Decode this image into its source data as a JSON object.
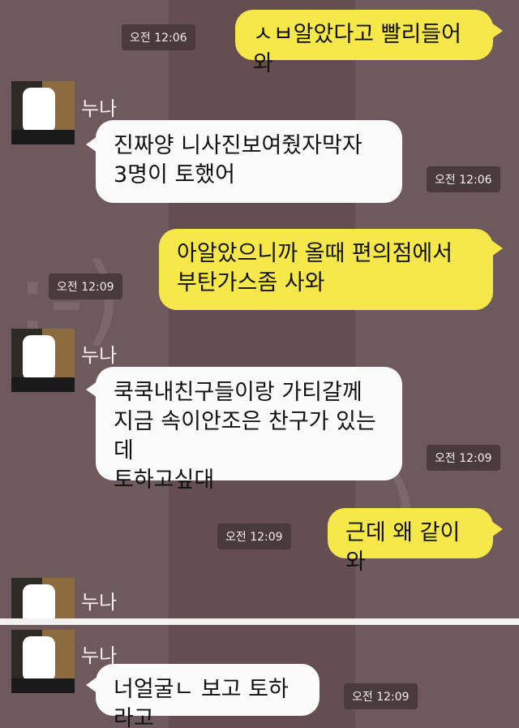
{
  "chat": {
    "sender_name": "누나",
    "messages": [
      {
        "from": "me",
        "lines": [
          "ㅅㅂ알았다고 빨리들어와"
        ],
        "time": "오전 12:06"
      },
      {
        "from": "other",
        "lines": [
          "진짜양 니사진보여줬자막자",
          "3명이 토했어"
        ],
        "time": "오전 12:06"
      },
      {
        "from": "me",
        "lines": [
          "아알았으니까 올때 편의점에서",
          "부탄가스좀 사와"
        ],
        "time": "오전 12:09"
      },
      {
        "from": "other",
        "lines": [
          "쿡쿡내친구들이랑 가티갈께",
          "지금 속이안조은 찬구가 있는데",
          "토하고싶대"
        ],
        "time": "오전 12:09"
      },
      {
        "from": "me",
        "lines": [
          "근데 왜 같이와"
        ],
        "time": "오전 12:09"
      },
      {
        "from": "other",
        "lines": [
          "너얼굴ㄴ 보고 토하라고"
        ],
        "time": "오전 12:09"
      }
    ]
  },
  "colors": {
    "background": "#6e5a5e",
    "my_bubble": "#f7e84a",
    "their_bubble": "#fbfbfb"
  },
  "icons": {
    "avatar": "profile-photo"
  }
}
